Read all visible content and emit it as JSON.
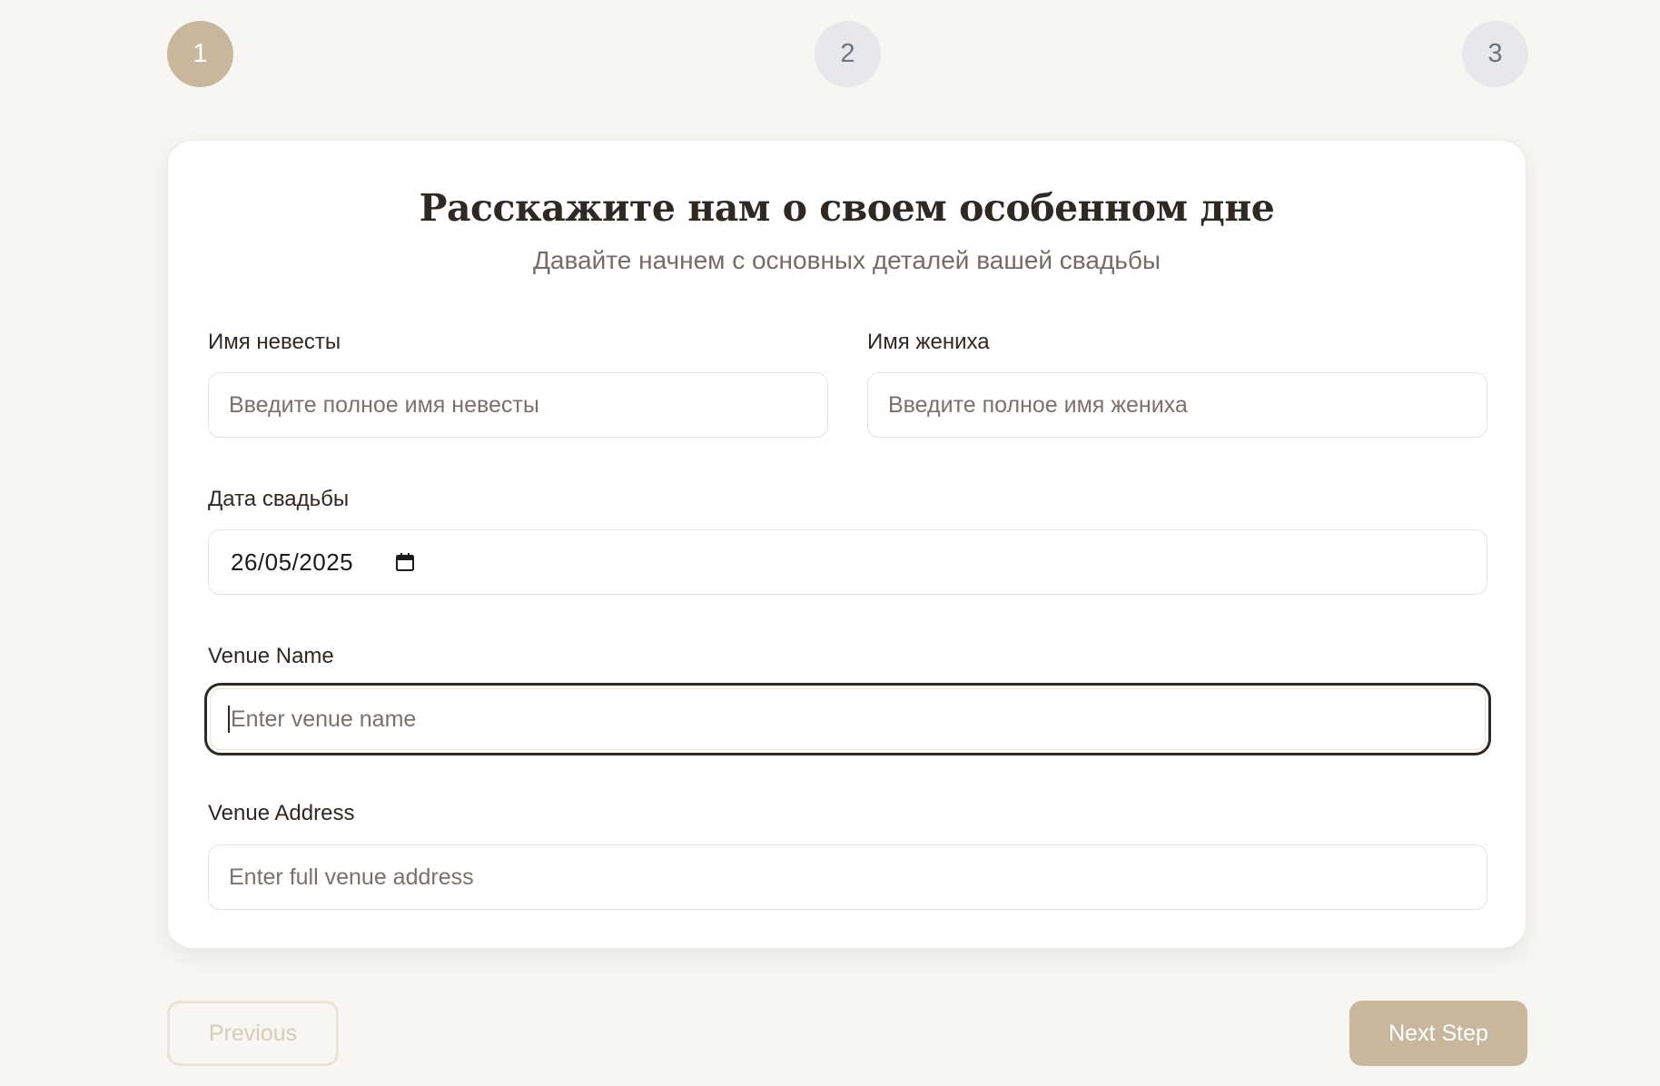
{
  "stepper": {
    "steps": [
      {
        "label": "1",
        "state": "active"
      },
      {
        "label": "2",
        "state": "inactive"
      },
      {
        "label": "3",
        "state": "inactive"
      }
    ]
  },
  "form": {
    "title": "Расскажите нам о своем особенном дне",
    "subtitle": "Давайте начнем с основных деталей вашей свадьбы",
    "bride_name": {
      "label": "Имя невесты",
      "placeholder": "Введите полное имя невесты",
      "value": ""
    },
    "groom_name": {
      "label": "Имя жениха",
      "placeholder": "Введите полное имя жениха",
      "value": ""
    },
    "wedding_date": {
      "label": "Дата свадьбы",
      "value": "26/05/2025",
      "icon": "calendar-icon"
    },
    "venue_name": {
      "label": "Venue Name",
      "placeholder": "Enter venue name",
      "value": "",
      "focused": true
    },
    "venue_address": {
      "label": "Venue Address",
      "placeholder": "Enter full venue address",
      "value": ""
    }
  },
  "navigation": {
    "previous_label": "Previous",
    "previous_disabled": true,
    "next_label": "Next Step"
  },
  "colors": {
    "background": "#f7f6f3",
    "accent": "#c8b79d",
    "text_dark": "#2f2924",
    "text_muted": "#756c64",
    "step_inactive_bg": "#e6e8ec",
    "focus_border": "#2f2924"
  }
}
